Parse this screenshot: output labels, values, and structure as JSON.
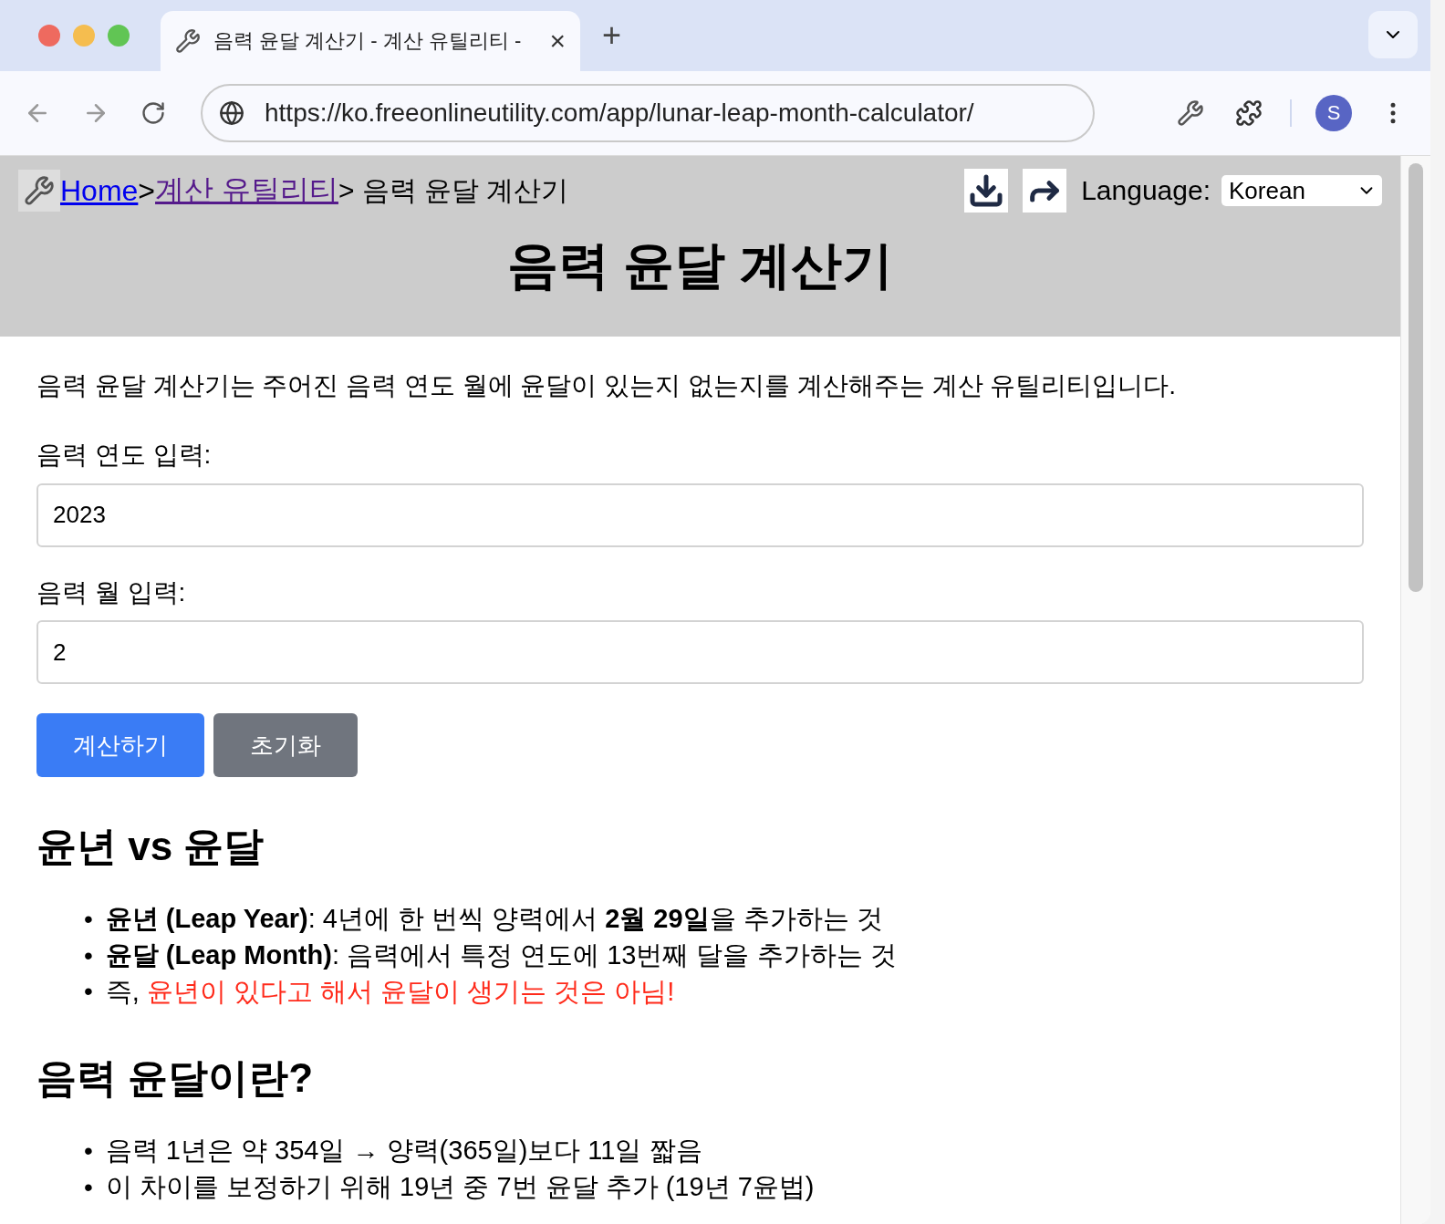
{
  "browser": {
    "tab": {
      "title": "음력 윤달 계산기 - 계산 유틸리티 -",
      "selected": true
    },
    "new_tab": "+",
    "close": "×",
    "url": "https://ko.freeonlineutility.com/app/lunar-leap-month-calculator/",
    "profile": "S"
  },
  "page": {
    "breadcrumb": [
      {
        "label": "Home",
        "visited": false
      },
      {
        "label": "계산 유틸리티",
        "visited": true
      }
    ],
    "breadcrumb_separator": ">",
    "breadcrumb_current": "> 음력 윤달 계산기",
    "language_label": "Language:",
    "language": "Korean",
    "title": "음력 윤달 계산기",
    "bullet": "•",
    "description": "음력 윤달 계산기는 주어진 음력 연도 월에 윤달이 있는지 없는지를 계산해주는 계산 유틸리티입니다.",
    "fields": [
      {
        "label": "음력 연도 입력:",
        "value": "2023"
      },
      {
        "label": "음력 월 입력:",
        "value": "2"
      }
    ],
    "buttons": [
      {
        "label": "계산하기",
        "kind": "primary"
      },
      {
        "label": "초기화",
        "kind": "secondary"
      }
    ],
    "sections": [
      {
        "heading": "윤년 vs 윤달",
        "items": [
          {
            "text": "**윤년 (Leap Year)**: 4년에 한 번씩 양력에서 **2월 29일**을 추가하는 것"
          },
          {
            "text": "**윤달 (Leap Month)**: 음력에서 특정 연도에 13번째 달을 추가하는 것"
          },
          {
            "text": "즉, ",
            "highlight": "윤년이 있다고 해서 윤달이 생기는 것은 아님!",
            "color": "#ff2a1a"
          }
        ]
      },
      {
        "heading": "음력 윤달이란?",
        "items": [
          {
            "text": "음력 1년은 약 354일 → 양력(365일)보다 11일 짧음"
          },
          {
            "text": "이 차이를 보정하기 위해 19년 중 7번 윤달 추가 (19년 7윤법)"
          }
        ]
      }
    ]
  }
}
